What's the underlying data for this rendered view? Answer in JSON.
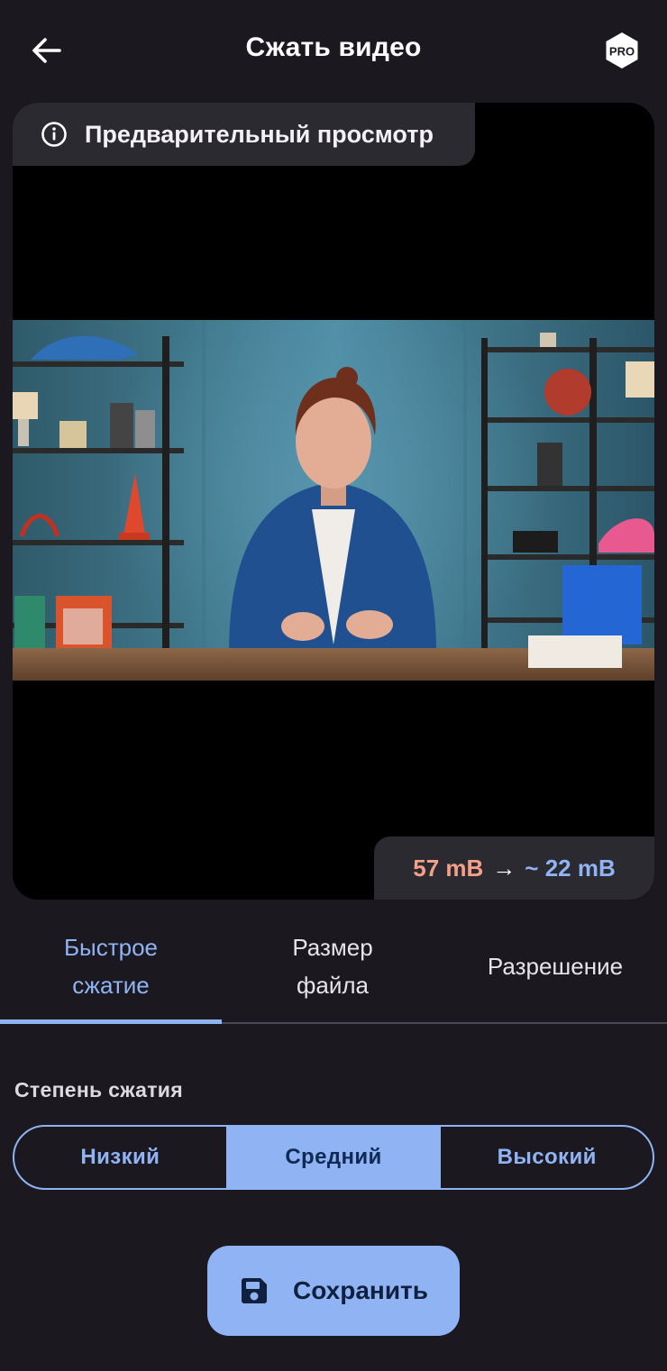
{
  "header": {
    "title": "Сжать видео",
    "back_icon": "arrow-left-icon",
    "pro_badge": "PRO"
  },
  "preview": {
    "label": "Предварительный просмотр",
    "info_icon": "info-icon",
    "size_original": "57 mB",
    "size_arrow": "→",
    "size_estimated": "~ 22 mB"
  },
  "tabs": [
    {
      "label": "Быстрое сжатие",
      "active": true
    },
    {
      "label": "Размер файла",
      "active": false
    },
    {
      "label": "Разрешение",
      "active": false
    }
  ],
  "compression": {
    "label": "Степень сжатия",
    "options": [
      "Низкий",
      "Средний",
      "Высокий"
    ],
    "selected": "Средний"
  },
  "save_button": {
    "label": "Сохранить",
    "icon": "floppy-disk-icon"
  },
  "colors": {
    "background": "#1b1820",
    "accent": "#8fb3f3",
    "size_original": "#f4a089",
    "chip_bg": "#2b2a30"
  }
}
